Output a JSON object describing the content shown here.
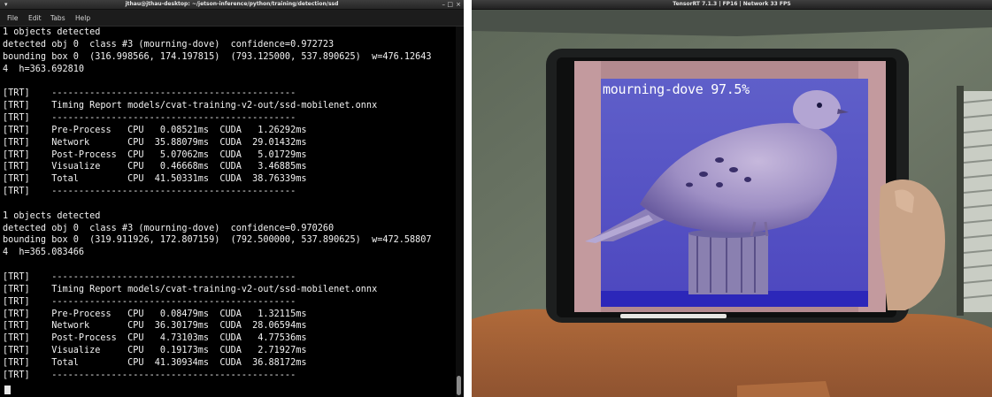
{
  "terminal": {
    "title": "jthau@jthau-desktop: ~/jetson-inference/python/training/detection/ssd",
    "window_controls": {
      "menu": "▾",
      "minimize": "–",
      "maximize": "□",
      "close": "×"
    },
    "menu": [
      "File",
      "Edit",
      "Tabs",
      "Help"
    ],
    "lines": [
      "1 objects detected",
      "detected obj 0  class #3 (mourning-dove)  confidence=0.972723",
      "bounding box 0  (316.998566, 174.197815)  (793.125000, 537.890625)  w=476.12643",
      "4  h=363.692810",
      "",
      "[TRT]    ---------------------------------------------",
      "[TRT]    Timing Report models/cvat-training-v2-out/ssd-mobilenet.onnx",
      "[TRT]    ---------------------------------------------",
      "[TRT]    Pre-Process   CPU   0.08521ms  CUDA   1.26292ms",
      "[TRT]    Network       CPU  35.88079ms  CUDA  29.01432ms",
      "[TRT]    Post-Process  CPU   5.07062ms  CUDA   5.01729ms",
      "[TRT]    Visualize     CPU   0.46668ms  CUDA   3.46885ms",
      "[TRT]    Total         CPU  41.50331ms  CUDA  38.76339ms",
      "[TRT]    ---------------------------------------------",
      "",
      "1 objects detected",
      "detected obj 0  class #3 (mourning-dove)  confidence=0.970260",
      "bounding box 0  (319.911926, 172.807159)  (792.500000, 537.890625)  w=472.58807",
      "4  h=365.083466",
      "",
      "[TRT]    ---------------------------------------------",
      "[TRT]    Timing Report models/cvat-training-v2-out/ssd-mobilenet.onnx",
      "[TRT]    ---------------------------------------------",
      "[TRT]    Pre-Process   CPU   0.08479ms  CUDA   1.32115ms",
      "[TRT]    Network       CPU  36.30179ms  CUDA  28.06594ms",
      "[TRT]    Post-Process  CPU   4.73103ms  CUDA   4.77536ms",
      "[TRT]    Visualize     CPU   0.19173ms  CUDA   2.71927ms",
      "[TRT]    Total         CPU  41.30934ms  CUDA  36.88172ms",
      "[TRT]    ---------------------------------------------"
    ]
  },
  "viewer": {
    "title": "TensorRT 7.1.3 | FP16 | Network 33 FPS",
    "detection": {
      "label": "mourning-dove 97.5%",
      "class": "mourning-dove",
      "confidence_percent": 97.5,
      "overlay_color": "#3a36d8"
    }
  },
  "colors": {
    "terminal_bg": "#000000",
    "terminal_text": "#f2f2f2",
    "titlebar": "#2e2e2e",
    "overlay": "#3a36d8"
  }
}
